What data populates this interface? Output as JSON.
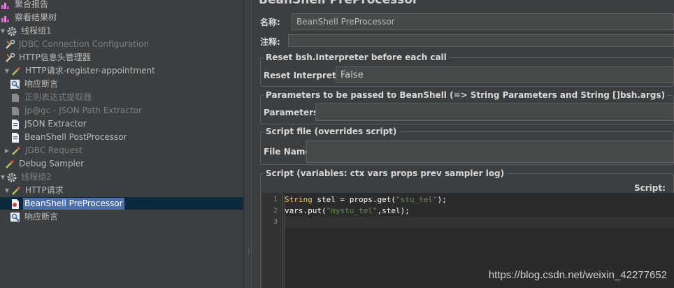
{
  "tree": {
    "items": [
      {
        "label": "聚合报告",
        "icon": "report-icon",
        "level": 0,
        "disabled": false
      },
      {
        "label": "察看结果树",
        "icon": "report-icon",
        "level": 0,
        "disabled": false
      },
      {
        "label": "线程组1",
        "icon": "gear-icon",
        "level": 0,
        "disabled": false,
        "toggle": "▼"
      },
      {
        "label": "JDBC Connection Configuration",
        "icon": "wrench-icon",
        "level": 1,
        "disabled": true
      },
      {
        "label": "HTTP信息头管理器",
        "icon": "wrench-icon",
        "level": 1,
        "disabled": false
      },
      {
        "label": "HTTP请求-register-appointment",
        "icon": "pipette-icon",
        "level": 1,
        "disabled": false,
        "toggle": "▼"
      },
      {
        "label": "响应断言",
        "icon": "magnifier-icon",
        "level": 2,
        "disabled": false
      },
      {
        "label": "正则表达式提取器",
        "icon": "extractor-icon",
        "level": 2,
        "disabled": true
      },
      {
        "label": "jp@gc - JSON Path Extractor",
        "icon": "extractor-icon",
        "level": 2,
        "disabled": true
      },
      {
        "label": "JSON Extractor",
        "icon": "document-icon",
        "level": 2,
        "disabled": false
      },
      {
        "label": "BeanShell PostProcessor",
        "icon": "document-icon",
        "level": 2,
        "disabled": false
      },
      {
        "label": "JDBC Request",
        "icon": "pipette-icon",
        "level": 1,
        "disabled": true,
        "toggle": "▶"
      },
      {
        "label": "Debug Sampler",
        "icon": "pipette-icon",
        "level": 1,
        "disabled": false
      },
      {
        "label": "线程组2",
        "icon": "gear-icon",
        "level": 0,
        "disabled": true,
        "toggle": "▼"
      },
      {
        "label": "HTTP请求",
        "icon": "pipette-icon",
        "level": 1,
        "disabled": false,
        "toggle": "▼"
      },
      {
        "label": "BeanShell PreProcessor",
        "icon": "document-red-icon",
        "level": 2,
        "disabled": false,
        "selected": true
      },
      {
        "label": "响应断言",
        "icon": "magnifier-icon",
        "level": 2,
        "disabled": false
      }
    ]
  },
  "panel": {
    "title": "BeanShell PreProcessor",
    "name_label": "名称:",
    "name_value": "BeanShell PreProcessor",
    "comment_label": "注释:",
    "comment_value": "",
    "reset_group": "Reset bsh.Interpreter before each call",
    "reset_label": "Reset Interpreter:",
    "reset_value": "False",
    "params_group": "Parameters to be passed to BeanShell (=> String Parameters and String []bsh.args)",
    "params_label": "Parameters:",
    "params_value": "",
    "file_group": "Script file (overrides script)",
    "file_label": "File Name:",
    "file_value": "",
    "script_group": "Script (variables: ctx vars props prev sampler log)",
    "script_label": "Script:"
  },
  "editor": {
    "line_numbers": [
      "1",
      "2",
      "3"
    ],
    "line1": {
      "kw": "String",
      "a": " stel = props.get(",
      "s": "\"stu_tel\"",
      "b": ");"
    },
    "line2": {
      "a": "vars.put(",
      "s": "\"mystu_tel\"",
      "b": ",stel);"
    }
  },
  "watermark": "https://blog.csdn.net/weixin_42277652"
}
